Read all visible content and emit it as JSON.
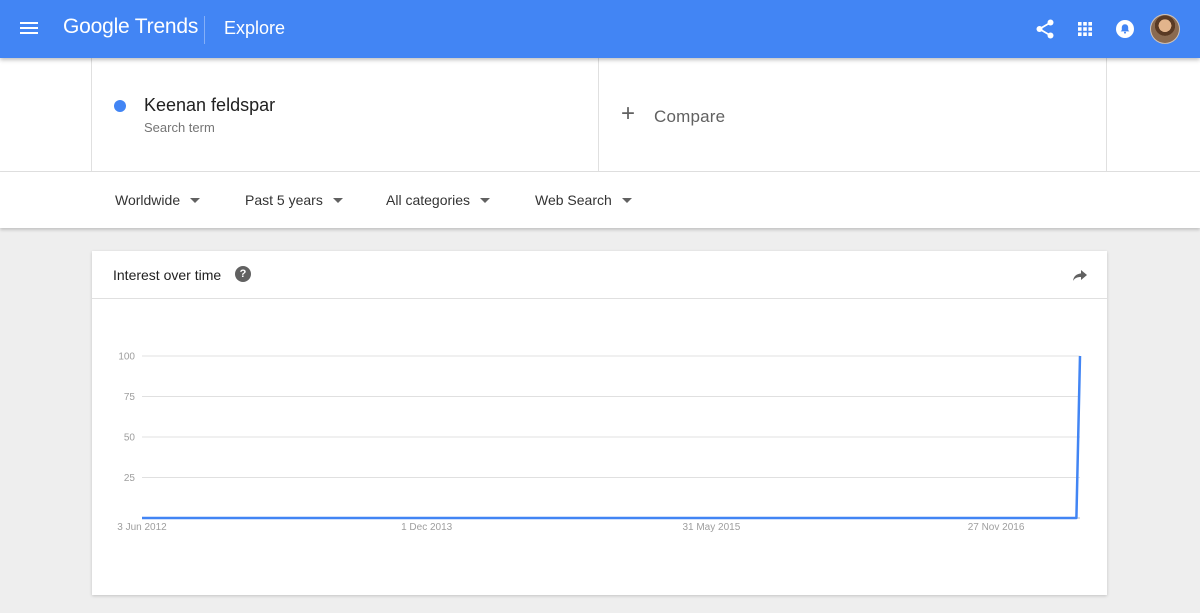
{
  "appbar": {
    "brand_google": "Google",
    "brand_product": "Trends",
    "page": "Explore",
    "icons": [
      "menu-icon",
      "share-icon",
      "apps-icon",
      "notifications-icon",
      "avatar"
    ],
    "color": "#4285f4"
  },
  "terms": {
    "term": {
      "name": "Keenan feldspar",
      "type": "Search term",
      "color": "#4285f4"
    },
    "compare": {
      "plus": "+",
      "label": "Compare"
    }
  },
  "filters": [
    {
      "label": "Worldwide"
    },
    {
      "label": "Past 5 years"
    },
    {
      "label": "All categories"
    },
    {
      "label": "Web Search"
    }
  ],
  "card": {
    "title": "Interest over time",
    "help": "?"
  },
  "chart_data": {
    "type": "line",
    "title": "",
    "xlabel": "",
    "ylabel": "",
    "ylim": [
      0,
      100
    ],
    "yticks": [
      "100",
      "75",
      "50",
      "25"
    ],
    "xticks": [
      "3 Jun 2012",
      "1 Dec 2013",
      "31 May 2015",
      "27 Nov 2016"
    ],
    "grid": true,
    "series": [
      {
        "color": "#4285f4",
        "points": [
          {
            "x": "2012-06-03",
            "y": 0
          },
          {
            "x": "2017-04-30",
            "y": 0
          },
          {
            "x": "2017-05-07",
            "y": 100
          }
        ]
      }
    ]
  }
}
